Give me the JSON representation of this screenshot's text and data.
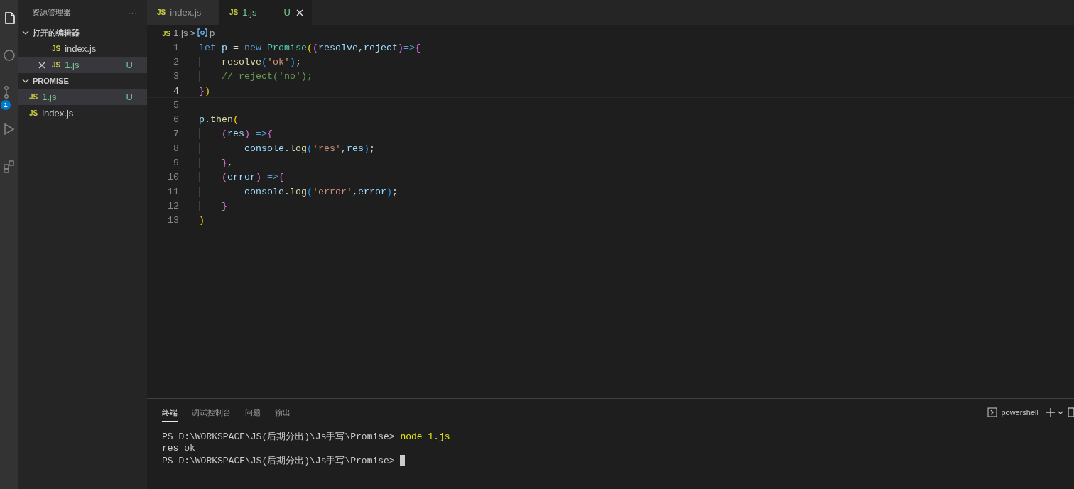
{
  "activity_bar": {
    "items": [
      {
        "kind": "files",
        "selected": true
      },
      {
        "kind": "search",
        "selected": false
      },
      {
        "kind": "source-control",
        "selected": false,
        "badge": "1"
      },
      {
        "kind": "run",
        "selected": false
      },
      {
        "kind": "extensions",
        "selected": false
      }
    ]
  },
  "sidebar": {
    "title": "资源管理器",
    "more": "···",
    "sections": [
      {
        "title": "打开的编辑器",
        "expanded": true,
        "items": [
          {
            "icon_text": "JS",
            "name": "index.js",
            "selected": false,
            "closable": false
          },
          {
            "icon_text": "JS",
            "name": "1.js",
            "status": "U",
            "selected": true,
            "closable": true
          }
        ]
      },
      {
        "title": "PROMISE",
        "expanded": true,
        "items": [
          {
            "icon_text": "JS",
            "name": "1.js",
            "status": "U",
            "selected": true
          },
          {
            "icon_text": "JS",
            "name": "index.js",
            "selected": false
          }
        ]
      }
    ]
  },
  "tabs": [
    {
      "icon_text": "JS",
      "label": "index.js",
      "selected": false,
      "closable": false
    },
    {
      "icon_text": "JS",
      "label": "1.js",
      "status": "U",
      "selected": true,
      "closable": true
    }
  ],
  "breadcrumb": {
    "icon_text": "JS",
    "file": "1.js",
    "separator": ">",
    "symbol": "p"
  },
  "code": {
    "lines": [
      {
        "number": "1",
        "current": false,
        "text": "let p = new Promise((resolve,reject)=>{"
      },
      {
        "number": "2",
        "current": false,
        "text": "    resolve('ok');"
      },
      {
        "number": "3",
        "current": false,
        "text": "    // reject('no');"
      },
      {
        "number": "4",
        "current": true,
        "text": "})"
      },
      {
        "number": "5",
        "current": false
      },
      {
        "number": "6",
        "current": false,
        "text": "p.then("
      },
      {
        "number": "7",
        "current": false,
        "text": "    (res) =>{"
      },
      {
        "number": "8",
        "current": false,
        "text": "        console.log('res',res);"
      },
      {
        "number": "9",
        "current": false,
        "text": "    },"
      },
      {
        "number": "10",
        "current": false,
        "text": "    (error) =>{"
      },
      {
        "number": "11",
        "current": false,
        "text": "        console.log('error',error);"
      },
      {
        "number": "12",
        "current": false,
        "text": "    }"
      },
      {
        "number": "13",
        "current": false,
        "text": ")"
      }
    ]
  },
  "panel": {
    "tabs": [
      {
        "label": "终端",
        "selected": true
      },
      {
        "label": "调试控制台",
        "selected": false
      },
      {
        "label": "问题",
        "selected": false
      },
      {
        "label": "输出",
        "selected": false
      }
    ],
    "shell": "powershell",
    "terminal": [
      {
        "prompt": "PS D:\\WORKSPACE\\JS(后期分出)\\Js手写\\Promise> ",
        "command": "node 1.js"
      },
      {
        "output": "res ok"
      },
      {
        "prompt": "PS D:\\WORKSPACE\\JS(后期分出)\\Js手写\\Promise> ",
        "cursor": true
      }
    ]
  }
}
